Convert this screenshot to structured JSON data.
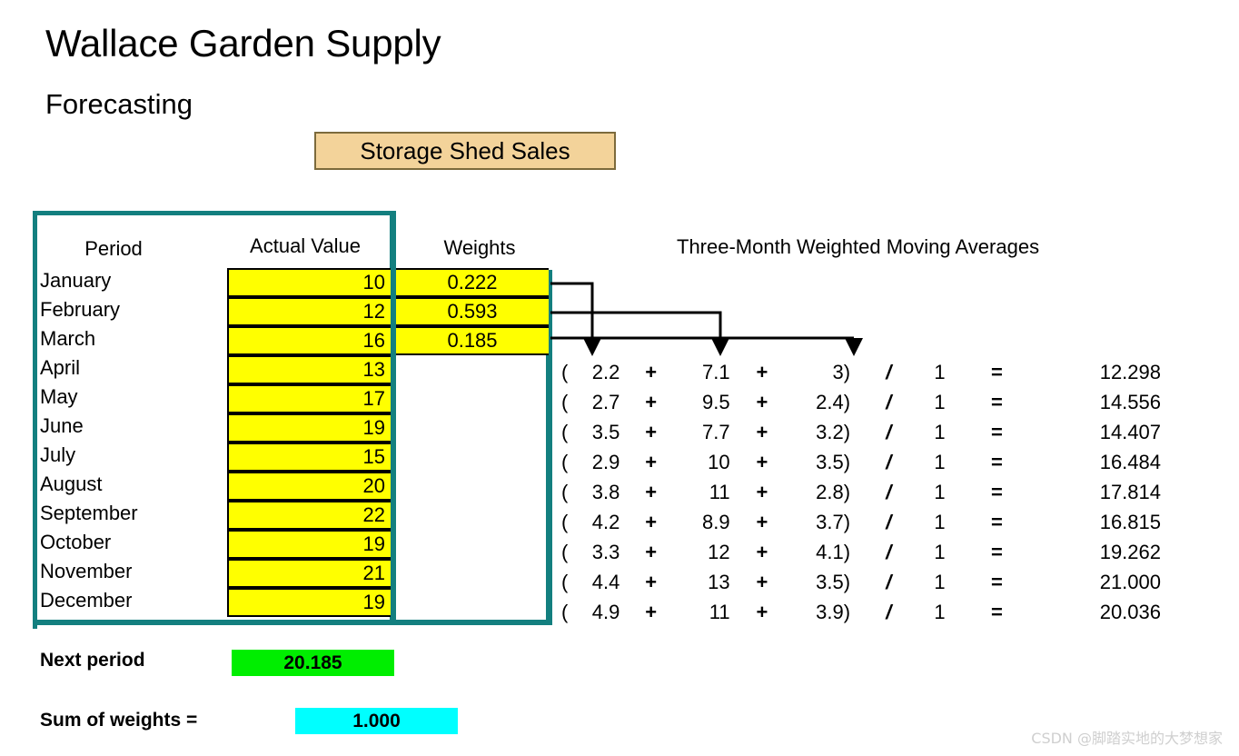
{
  "header": {
    "main_title": "Wallace Garden Supply",
    "sub_title": "Forecasting",
    "banner_label": "Storage Shed Sales",
    "banner_fill": "#F3D39A",
    "banner_border": "#7C6A3C"
  },
  "colors": {
    "teal_frame": "#137F7F",
    "cell_yellow": "#FFFF00",
    "next_period_green": "#00EE00",
    "sum_weights_cyan": "#00FFFF"
  },
  "table": {
    "headers": {
      "period": "Period",
      "actual_value": "Actual Value",
      "weights": "Weights",
      "moving_averages": "Three-Month Weighted Moving Averages"
    },
    "rows": [
      {
        "period": "January",
        "actual": "10",
        "weight": "0.222"
      },
      {
        "period": "February",
        "actual": "12",
        "weight": "0.593"
      },
      {
        "period": "March",
        "actual": "16",
        "weight": "0.185"
      },
      {
        "period": "April",
        "actual": "13",
        "weight": ""
      },
      {
        "period": "May",
        "actual": "17",
        "weight": ""
      },
      {
        "period": "June",
        "actual": "19",
        "weight": ""
      },
      {
        "period": "July",
        "actual": "15",
        "weight": ""
      },
      {
        "period": "August",
        "actual": "20",
        "weight": ""
      },
      {
        "period": "September",
        "actual": "22",
        "weight": ""
      },
      {
        "period": "October",
        "actual": "19",
        "weight": ""
      },
      {
        "period": "November",
        "actual": "21",
        "weight": ""
      },
      {
        "period": "December",
        "actual": "19",
        "weight": ""
      }
    ]
  },
  "calculations": {
    "operator_plus": "+",
    "operator_divide": "/",
    "operator_equals": "=",
    "paren_open": "(",
    "paren_close": ")",
    "rows": [
      {
        "t1": "2.2",
        "t2": "7.1",
        "t3": "3",
        "denom": "1",
        "result": "12.298"
      },
      {
        "t1": "2.7",
        "t2": "9.5",
        "t3": "2.4",
        "denom": "1",
        "result": "14.556"
      },
      {
        "t1": "3.5",
        "t2": "7.7",
        "t3": "3.2",
        "denom": "1",
        "result": "14.407"
      },
      {
        "t1": "2.9",
        "t2": "10",
        "t3": "3.5",
        "denom": "1",
        "result": "16.484"
      },
      {
        "t1": "3.8",
        "t2": "11",
        "t3": "2.8",
        "denom": "1",
        "result": "17.814"
      },
      {
        "t1": "4.2",
        "t2": "8.9",
        "t3": "3.7",
        "denom": "1",
        "result": "16.815"
      },
      {
        "t1": "3.3",
        "t2": "12",
        "t3": "4.1",
        "denom": "1",
        "result": "19.262"
      },
      {
        "t1": "4.4",
        "t2": "13",
        "t3": "3.5",
        "denom": "1",
        "result": "21.000"
      },
      {
        "t1": "4.9",
        "t2": "11",
        "t3": "3.9",
        "denom": "1",
        "result": "20.036"
      }
    ]
  },
  "footer": {
    "next_period_label": "Next period",
    "next_period_value": "20.185",
    "sum_weights_label": "Sum of weights =",
    "sum_weights_value": "1.000"
  },
  "watermark": {
    "text": "CSDN @脚踏实地的大梦想家"
  },
  "chart_data": {
    "type": "table",
    "title": "Storage Shed Sales — Three-Month Weighted Moving Averages",
    "categories": [
      "January",
      "February",
      "March",
      "April",
      "May",
      "June",
      "July",
      "August",
      "September",
      "October",
      "November",
      "December"
    ],
    "series": [
      {
        "name": "Actual Value",
        "values": [
          10,
          12,
          16,
          13,
          17,
          19,
          15,
          20,
          22,
          19,
          21,
          19
        ]
      },
      {
        "name": "Three-Month Weighted Moving Average",
        "values": [
          null,
          null,
          null,
          12.298,
          14.556,
          14.407,
          16.484,
          17.814,
          16.815,
          19.262,
          21.0,
          20.036
        ]
      }
    ],
    "weights": [
      0.222,
      0.593,
      0.185
    ],
    "weights_sum": 1.0,
    "next_period_forecast": 20.185,
    "xlabel": "Period",
    "ylabel": "Sales"
  }
}
